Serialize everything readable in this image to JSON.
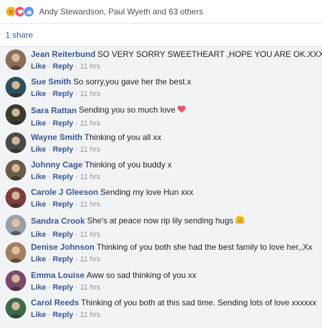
{
  "reactions": {
    "names": "Andy Stewardson, Paul Wyeth and 63 others",
    "icons": [
      "sad-reaction-icon",
      "love-reaction-icon",
      "like-reaction-icon"
    ]
  },
  "shares_label": "1 share",
  "actions": {
    "like": "Like",
    "reply": "Reply",
    "separator": "·"
  },
  "comments": [
    {
      "author": "Jean Reiterbund",
      "text": "SO VERY SORRY SWEETHEART ,HOPE YOU ARE OK.XXX",
      "time": "11 hrs",
      "avatar_color": "#8a6e5a"
    },
    {
      "author": "Sue Smith",
      "text": "So sorry,you gave her the best.x",
      "time": "11 hrs",
      "avatar_color": "#2f4f5a"
    },
    {
      "author": "Sara Rattan",
      "text": "Sending you so much love",
      "time": "11 hrs",
      "avatar_color": "#3a3a2e",
      "emoji": "heart"
    },
    {
      "author": "Wayne Smith",
      "text": "Thinking of you all xx",
      "time": "11 hrs",
      "avatar_color": "#4a4a4a"
    },
    {
      "author": "Johnny Cage",
      "text": "Thinking of you buddy x",
      "time": "11 hrs",
      "avatar_color": "#6b5a4a"
    },
    {
      "author": "Carole J Gleeson",
      "text": "Sending my love Hun xxx",
      "time": "11 hrs",
      "avatar_color": "#7a3e3e"
    },
    {
      "author": "Sandra Crook",
      "text": "She's at peace now rip lily sending hugs",
      "time": "11 hrs",
      "avatar_color": "#9aa0a8",
      "emoji": "hug"
    },
    {
      "author": "Denise Johnson",
      "text": "Thinking of you both she had the best family to love her,,Xx",
      "time": "11 hrs",
      "avatar_color": "#a08060"
    },
    {
      "author": "Emma Louise",
      "text": "Aww so sad thinking of you xx",
      "time": "11 hrs",
      "avatar_color": "#7a4a6a"
    },
    {
      "author": "Carol Reeds",
      "text": "Thinking of you both at this sad time. Sending lots of love xxxxxx",
      "time": "11 hrs",
      "avatar_color": "#3e6a4a"
    }
  ]
}
